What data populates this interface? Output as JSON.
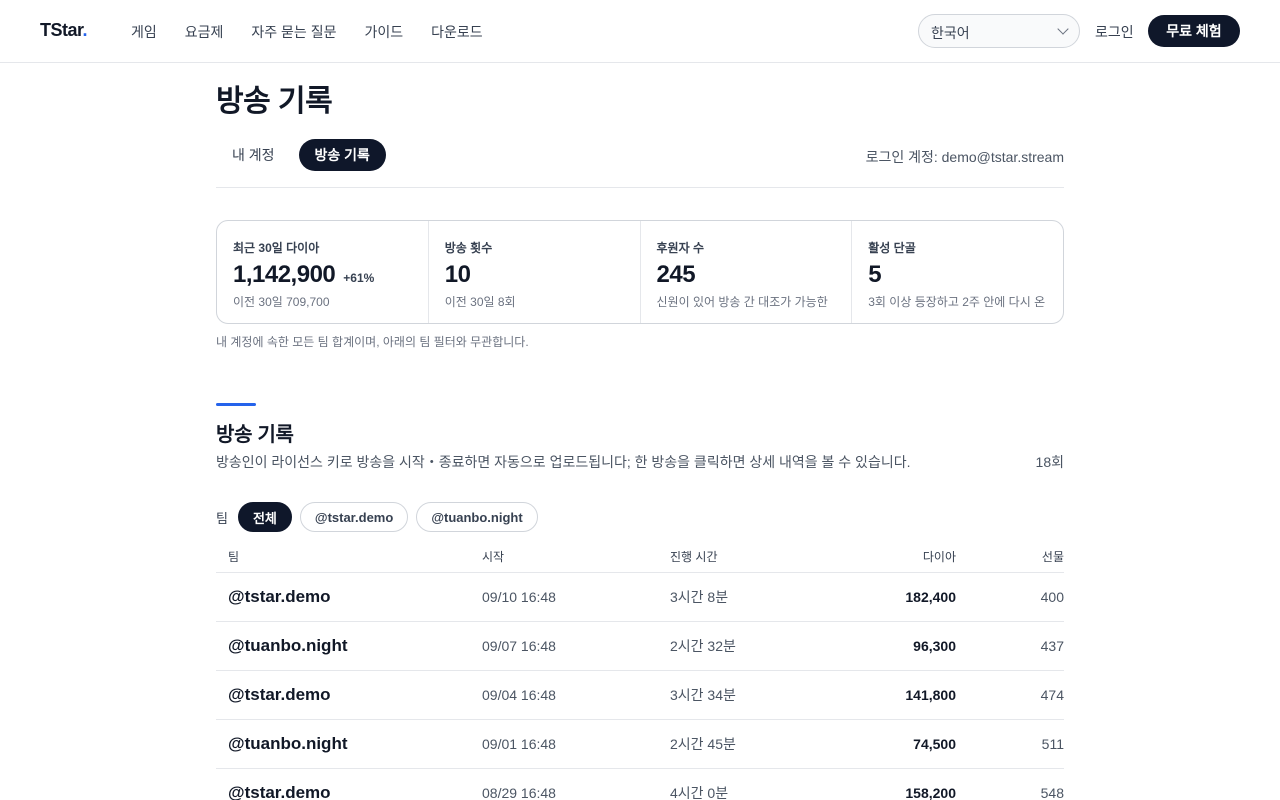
{
  "header": {
    "logo_text": "TStar",
    "logo_dot": ".",
    "nav": [
      "게임",
      "요금제",
      "자주 묻는 질문",
      "가이드",
      "다운로드"
    ],
    "language": "한국어",
    "login": "로그인",
    "trial": "무료 체험"
  },
  "page": {
    "title": "방송 기록",
    "tabs": [
      "내 계정",
      "방송 기록"
    ],
    "active_tab": "방송 기록",
    "account": "로그인 계정: demo@tstar.stream"
  },
  "stats": [
    {
      "label": "최근 30일 다이아",
      "value": "1,142,900",
      "delta": "+61%",
      "note": "이전 30일 709,700"
    },
    {
      "label": "방송 횟수",
      "value": "10",
      "delta": "",
      "note": "이전 30일 8회"
    },
    {
      "label": "후원자 수",
      "value": "245",
      "delta": "",
      "note": "신원이 있어 방송 간 대조가 가능한"
    },
    {
      "label": "활성 단골",
      "value": "5",
      "delta": "",
      "note": "3회 이상 등장하고 2주 안에 다시 온"
    }
  ],
  "stats_footnote": "내 계정에 속한 모든 팀 합계이며, 아래의 팀 필터와 무관합니다.",
  "section": {
    "title": "방송 기록",
    "description": "방송인이 라이선스 키로 방송을 시작・종료하면 자동으로 업로드됩니다; 한 방송을 클릭하면 상세 내역을 볼 수 있습니다.",
    "count": "18회"
  },
  "filters": {
    "label": "팀",
    "chips": [
      "전체",
      "@tstar.demo",
      "@tuanbo.night"
    ],
    "active": "전체"
  },
  "table": {
    "columns": {
      "team": "팀",
      "start": "시작",
      "duration": "진행 시간",
      "diamonds": "다이아",
      "gifts": "선물"
    },
    "rows": [
      {
        "team": "@tstar.demo",
        "start": "09/10 16:48",
        "duration": "3시간 8분",
        "diamonds": "182,400",
        "gifts": "400"
      },
      {
        "team": "@tuanbo.night",
        "start": "09/07 16:48",
        "duration": "2시간 32분",
        "diamonds": "96,300",
        "gifts": "437"
      },
      {
        "team": "@tstar.demo",
        "start": "09/04 16:48",
        "duration": "3시간 34분",
        "diamonds": "141,800",
        "gifts": "474"
      },
      {
        "team": "@tuanbo.night",
        "start": "09/01 16:48",
        "duration": "2시간 45분",
        "diamonds": "74,500",
        "gifts": "511"
      },
      {
        "team": "@tstar.demo",
        "start": "08/29 16:48",
        "duration": "4시간 0분",
        "diamonds": "158,200",
        "gifts": "548"
      }
    ]
  },
  "colors": {
    "primary_dark": "#0f172a",
    "accent_blue": "#2563eb"
  }
}
